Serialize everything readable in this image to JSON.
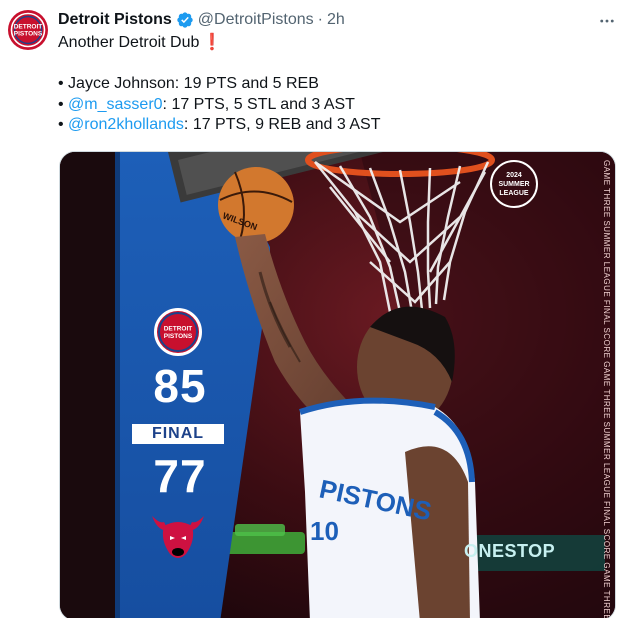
{
  "tweet": {
    "author_name": "Detroit Pistons",
    "handle": "@DetroitPistons",
    "separator": "·",
    "time": "2h",
    "lines": [
      {
        "plain": "Another Detroit Dub",
        "emoji": "❗"
      },
      {
        "bullet": "• ",
        "mention": "",
        "rest": "Jayce Johnson: 19 PTS and 5 REB"
      },
      {
        "bullet": "• ",
        "mention": "@m_sasser0",
        "rest": ": 17 PTS, 5 STL and 3 AST"
      },
      {
        "bullet": "• ",
        "mention": "@ron2khollands",
        "rest": ": 17 PTS, 9 REB and 3 AST"
      }
    ]
  },
  "media": {
    "home_score": "85",
    "status": "FINAL",
    "away_score": "77",
    "logo_text": [
      "DETROIT",
      "PISTONS"
    ],
    "badge_lines": [
      "2024",
      "SUMMER",
      "LEAGUE"
    ],
    "side_caption": "GAME THREE   SUMMER LEAGUE   FINAL SCORE   GAME THREE   SUMMER LEAGUE   FINAL SCORE   GAME THREE",
    "banner_text": "ONESTOP",
    "jersey_text": "PISTONS",
    "jersey_number": "10",
    "ball_text": "WILSON"
  },
  "colors": {
    "pistons_red": "#c8102e",
    "pistons_blue": "#1d428a",
    "link_blue": "#1d9bf0",
    "verified_blue": "#1d9bf0",
    "muted_gray": "#536471"
  },
  "icons": [
    "verified-badge-icon",
    "more-options-icon",
    "pistons-logo-icon",
    "bulls-logo-icon"
  ]
}
